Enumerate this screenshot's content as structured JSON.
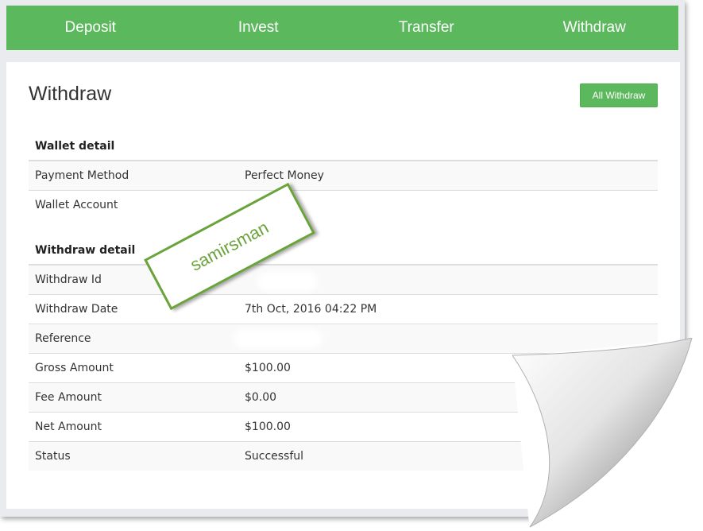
{
  "nav": {
    "items": [
      {
        "label": "Deposit"
      },
      {
        "label": "Invest"
      },
      {
        "label": "Transfer"
      },
      {
        "label": "Withdraw"
      }
    ]
  },
  "page": {
    "title": "Withdraw",
    "all_button_label": "All Withdraw"
  },
  "wallet": {
    "heading": "Wallet detail",
    "rows": [
      {
        "label": "Payment Method",
        "value": "Perfect Money"
      },
      {
        "label": "Wallet Account",
        "value": ""
      }
    ]
  },
  "withdraw": {
    "heading": "Withdraw detail",
    "rows": [
      {
        "label": "Withdraw Id",
        "value": ""
      },
      {
        "label": "Withdraw Date",
        "value": "7th Oct, 2016 04:22 PM"
      },
      {
        "label": "Reference",
        "value": ""
      },
      {
        "label": "Gross Amount",
        "value": "$100.00"
      },
      {
        "label": "Fee Amount",
        "value": "$0.00"
      },
      {
        "label": "Net Amount",
        "value": "$100.00"
      },
      {
        "label": "Status",
        "value": "Successful"
      }
    ]
  },
  "watermark": {
    "text": "samirsman"
  },
  "colors": {
    "accent": "#5cb85c",
    "stamp": "#6aa33a",
    "background": "#e9ebee"
  }
}
